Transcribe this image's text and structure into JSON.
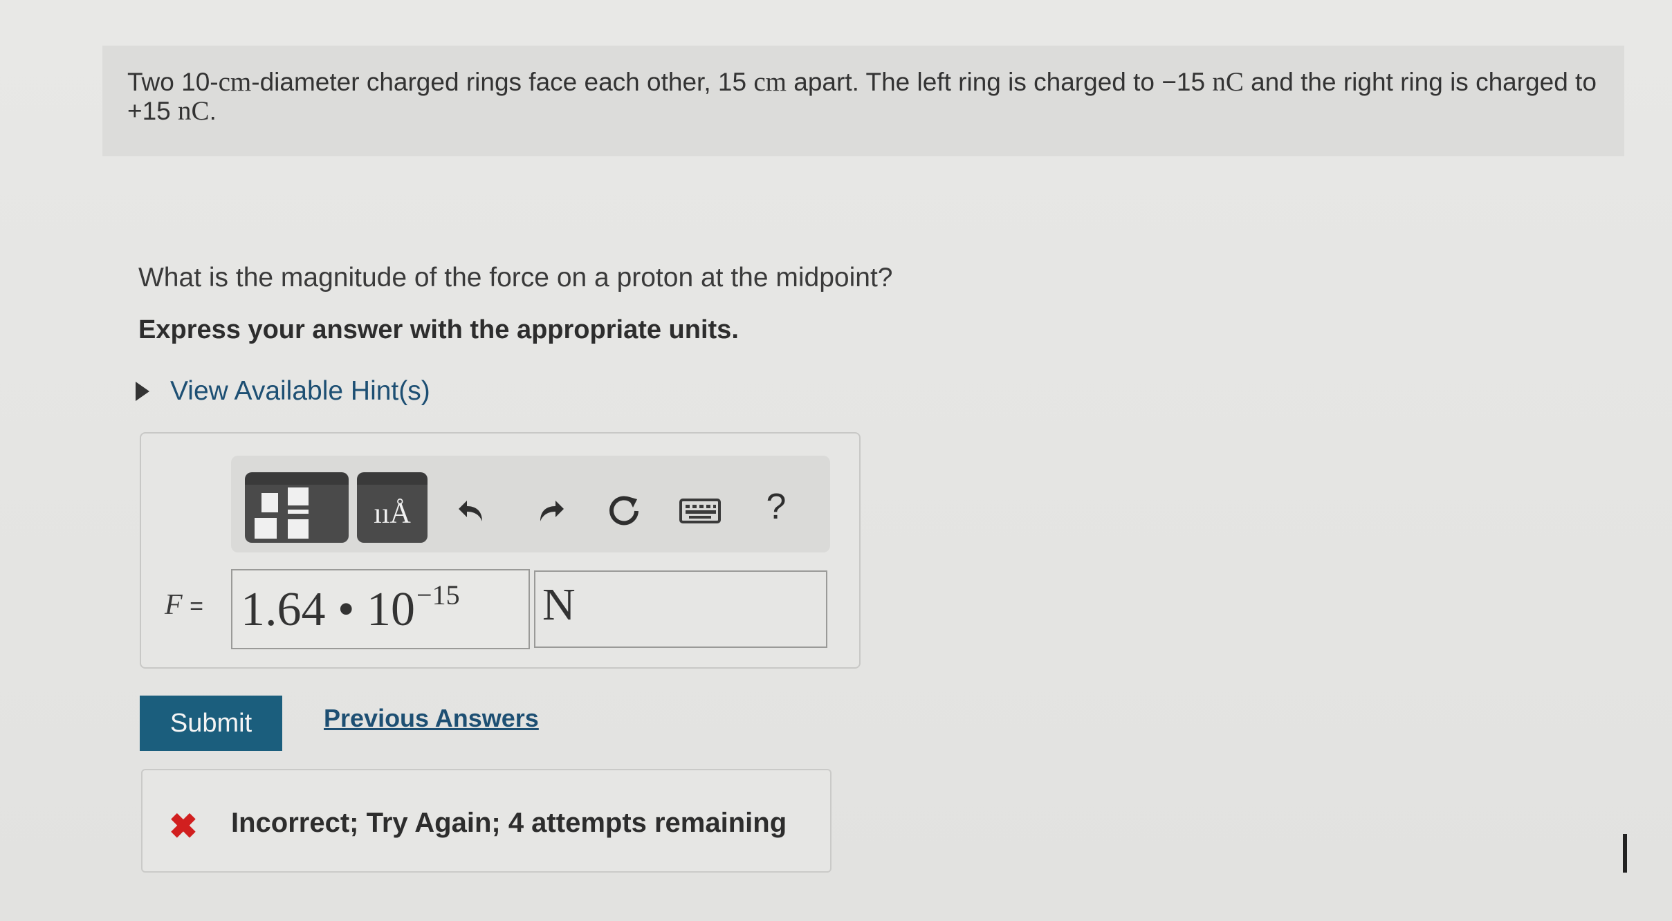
{
  "problem": {
    "text_1": "Two 10-",
    "unit_cm": "cm",
    "text_2": "-diameter charged rings face each other, 15 ",
    "unit_cm2": "cm",
    "text_3": " apart. The left ring is charged to ",
    "charge_left": "−15",
    "unit_nC1": "nC",
    "text_4": " and the right ring is charged to ",
    "charge_right": "+15",
    "unit_nC2": "nC",
    "text_5": "."
  },
  "question": "What is the magnitude of the force on a proton at the midpoint?",
  "instruction": "Express your answer with the appropriate units.",
  "hints_label": "View Available Hint(s)",
  "toolbar": {
    "units_glyph": "ııÅ",
    "help_label": "?"
  },
  "answer": {
    "variable": "F",
    "equals": "=",
    "mantissa": "1.64 • 10",
    "exponent": "−15",
    "unit": "N"
  },
  "submit_label": "Submit",
  "previous_answers_label": "Previous Answers",
  "feedback": {
    "icon": "✖",
    "message": "Incorrect; Try Again; 4 attempts remaining"
  },
  "colors": {
    "accent": "#1b5e7d",
    "link": "#1d4f73",
    "error": "#d11f1f"
  }
}
